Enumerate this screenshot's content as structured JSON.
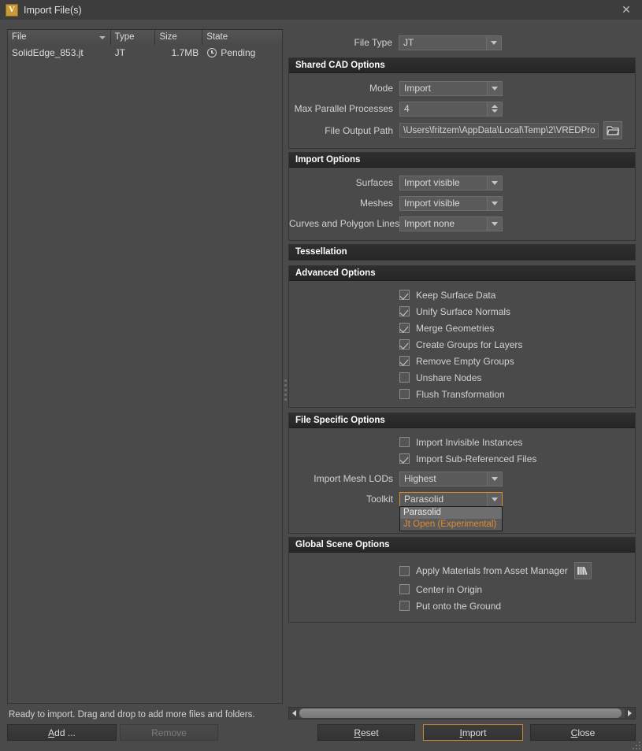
{
  "window": {
    "title": "Import File(s)",
    "icon": "vred-v-logo-icon",
    "logo_letter": "V",
    "close_label": "✕"
  },
  "file_list": {
    "columns": [
      "File",
      "Type",
      "Size",
      "State"
    ],
    "rows": [
      {
        "file": "SolidEdge_853.jt",
        "type": "JT",
        "size": "1.7MB",
        "state": "Pending"
      }
    ]
  },
  "options": {
    "file_type": {
      "label": "File Type",
      "value": "JT"
    },
    "shared_cad": {
      "title": "Shared CAD Options",
      "mode": {
        "label": "Mode",
        "value": "Import"
      },
      "max_parallel": {
        "label": "Max Parallel Processes",
        "value": "4"
      },
      "output_path": {
        "label": "File Output Path",
        "value": "\\Users\\fritzem\\AppData\\Local\\Temp\\2\\VREDPro",
        "browse_icon": "folder-open-icon"
      }
    },
    "import_options": {
      "title": "Import Options",
      "fields": [
        {
          "label": "Surfaces",
          "value": "Import visible"
        },
        {
          "label": "Meshes",
          "value": "Import visible"
        },
        {
          "label": "Curves and Polygon Lines",
          "value": "Import none"
        }
      ]
    },
    "tessellation": {
      "title": "Tessellation"
    },
    "advanced": {
      "title": "Advanced Options",
      "checkboxes": [
        {
          "label": "Keep Surface Data",
          "checked": true
        },
        {
          "label": "Unify Surface Normals",
          "checked": true
        },
        {
          "label": "Merge Geometries",
          "checked": true
        },
        {
          "label": "Create Groups for Layers",
          "checked": true
        },
        {
          "label": "Remove Empty Groups",
          "checked": true
        },
        {
          "label": "Unshare Nodes",
          "checked": false
        },
        {
          "label": "Flush Transformation",
          "checked": false
        }
      ]
    },
    "file_specific": {
      "title": "File Specific Options",
      "checkboxes": [
        {
          "label": "Import Invisible Instances",
          "checked": false
        },
        {
          "label": "Import Sub-Referenced Files",
          "checked": true
        }
      ],
      "mesh_lods": {
        "label": "Import Mesh LODs",
        "value": "Highest"
      },
      "toolkit": {
        "label": "Toolkit",
        "value": "Parasolid",
        "open": true,
        "items": [
          {
            "label": "Parasolid",
            "selected": true
          },
          {
            "label": "Jt Open (Experimental)",
            "selected": false
          }
        ]
      }
    },
    "global_scene": {
      "title": "Global Scene Options",
      "checkboxes": [
        {
          "label": "Apply Materials from Asset Manager",
          "checked": false,
          "icon": "asset-manager-books-icon"
        },
        {
          "label": "Center in Origin",
          "checked": false
        },
        {
          "label": "Put onto the Ground",
          "checked": false
        }
      ]
    }
  },
  "status": {
    "text": "Ready to import. Drag and drop to add more files and folders."
  },
  "buttons": {
    "add": {
      "pre": "A",
      "accel": "d",
      "post": "d ..."
    },
    "add_label": "Add ...",
    "remove_label": "Remove",
    "reset_label": "Reset",
    "import_label": "Import",
    "close_label": "Close"
  },
  "colors": {
    "accent": "#e08a2e",
    "window_bg": "#4a4a4a",
    "header_bg": "#2a2a2a",
    "text": "#d6d6d6"
  }
}
